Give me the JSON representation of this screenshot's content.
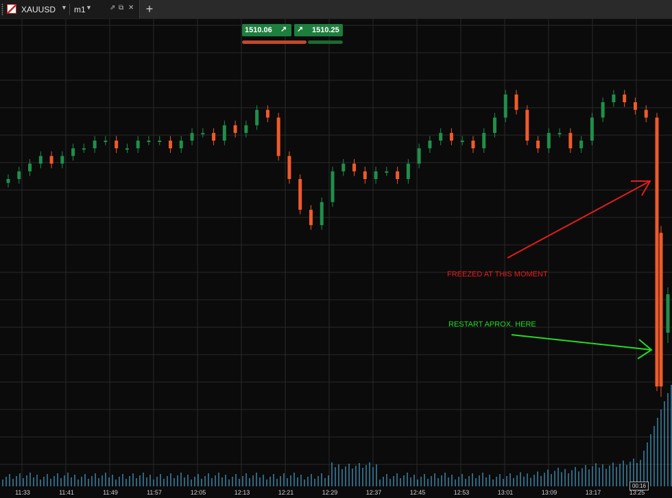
{
  "tab": {
    "symbol": "XAUUSD",
    "timeframe": "m1"
  },
  "trade": {
    "sell_price": "1510.06",
    "buy_price": "1510.25"
  },
  "annotations": {
    "freeze_text": "FREEZED AT THIS MOMENT",
    "restart_text": "RESTART APROX. HERE",
    "freeze_color": "#e81c1c",
    "restart_color": "#22dd22"
  },
  "countdown": "00:16",
  "colors": {
    "up": "#1f8f4a",
    "down": "#f05a2a",
    "volume": "#4fc3f7",
    "grid": "#2a2a2a",
    "background": "#0b0b0b"
  },
  "chart_data": {
    "type": "candlestick",
    "x_ticks": [
      "11:33",
      "11:41",
      "11:49",
      "11:57",
      "12:05",
      "12:13",
      "12:21",
      "12:29",
      "12:37",
      "12:45",
      "12:53",
      "13:01",
      "13:09",
      "13:17",
      "13:25"
    ],
    "y_range_estimate": [
      1507.5,
      1512.5
    ],
    "close_estimate": [
      1510.5,
      1510.6,
      1510.7,
      1510.8,
      1510.7,
      1510.8,
      1510.9,
      1510.9,
      1511.0,
      1511.0,
      1510.9,
      1510.9,
      1511.0,
      1511.0,
      1511.0,
      1510.9,
      1511.0,
      1511.1,
      1511.1,
      1511.0,
      1511.2,
      1511.1,
      1511.2,
      1511.4,
      1511.3,
      1510.8,
      1510.5,
      1510.1,
      1509.9,
      1510.2,
      1510.6,
      1510.7,
      1510.6,
      1510.5,
      1510.6,
      1510.6,
      1510.5,
      1510.7,
      1510.9,
      1511.0,
      1511.1,
      1511.0,
      1511.0,
      1510.9,
      1511.1,
      1511.3,
      1511.6,
      1511.4,
      1511.0,
      1510.9,
      1511.1,
      1511.1,
      1510.9,
      1511.0,
      1511.3,
      1511.5,
      1511.6,
      1511.5,
      1511.4,
      1511.3,
      1507.8
    ]
  }
}
